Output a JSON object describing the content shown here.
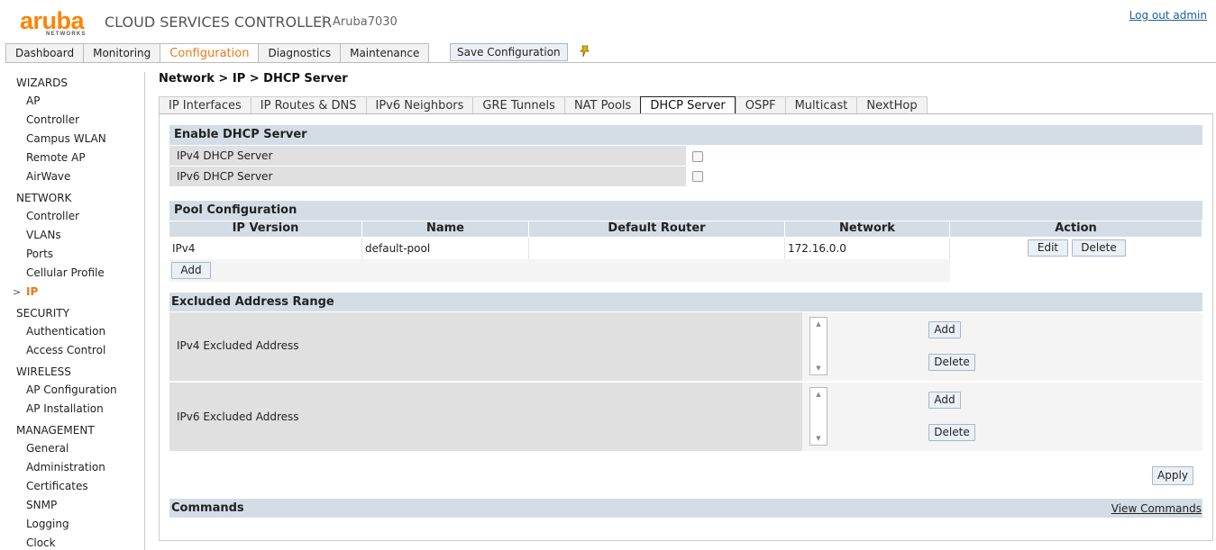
{
  "header": {
    "logo": "aruba",
    "logo_sub": "NETWORKS",
    "app_title": "CLOUD SERVICES CONTROLLER",
    "separator": "|",
    "host": "Aruba7030",
    "logout": "Log out admin",
    "save_config": "Save Configuration",
    "brand_color": "#ff8300"
  },
  "main_tabs": [
    {
      "label": "Dashboard"
    },
    {
      "label": "Monitoring"
    },
    {
      "label": "Configuration",
      "active": true
    },
    {
      "label": "Diagnostics"
    },
    {
      "label": "Maintenance"
    }
  ],
  "sidebar": {
    "sections": [
      {
        "title": "WIZARDS",
        "items": [
          "AP",
          "Controller",
          "Campus WLAN",
          "Remote AP",
          "AirWave"
        ]
      },
      {
        "title": "NETWORK",
        "items": [
          "Controller",
          "VLANs",
          "Ports",
          "Cellular Profile",
          "IP"
        ]
      },
      {
        "title": "SECURITY",
        "items": [
          "Authentication",
          "Access Control"
        ]
      },
      {
        "title": "WIRELESS",
        "items": [
          "AP Configuration",
          "AP Installation"
        ]
      },
      {
        "title": "MANAGEMENT",
        "items": [
          "General",
          "Administration",
          "Certificates",
          "SNMP",
          "Logging",
          "Clock"
        ]
      }
    ],
    "active_item": "IP",
    "active_marker": ">"
  },
  "breadcrumb": "Network > IP > DHCP Server",
  "sub_tabs": [
    {
      "label": "IP Interfaces"
    },
    {
      "label": "IP Routes & DNS"
    },
    {
      "label": "IPv6 Neighbors"
    },
    {
      "label": "GRE Tunnels"
    },
    {
      "label": "NAT Pools"
    },
    {
      "label": "DHCP Server",
      "active": true
    },
    {
      "label": "OSPF"
    },
    {
      "label": "Multicast"
    },
    {
      "label": "NextHop"
    }
  ],
  "enable_dhcp": {
    "title": "Enable DHCP Server",
    "ipv4_label": "IPv4 DHCP Server",
    "ipv4_checked": false,
    "ipv6_label": "IPv6 DHCP Server",
    "ipv6_checked": false
  },
  "pool": {
    "title": "Pool Configuration",
    "columns": [
      "IP Version",
      "Name",
      "Default Router",
      "Network",
      "Action"
    ],
    "rows": [
      {
        "ip_version": "IPv4",
        "name": "default-pool",
        "default_router": "",
        "network": "172.16.0.0",
        "edit": "Edit",
        "delete": "Delete"
      }
    ],
    "add": "Add"
  },
  "excluded": {
    "title": "Excluded Address Range",
    "ipv4_label": "IPv4 Excluded Address",
    "ipv6_label": "IPv6 Excluded Address",
    "add": "Add",
    "delete": "Delete"
  },
  "apply": "Apply",
  "commands": {
    "title": "Commands",
    "view": "View Commands"
  }
}
